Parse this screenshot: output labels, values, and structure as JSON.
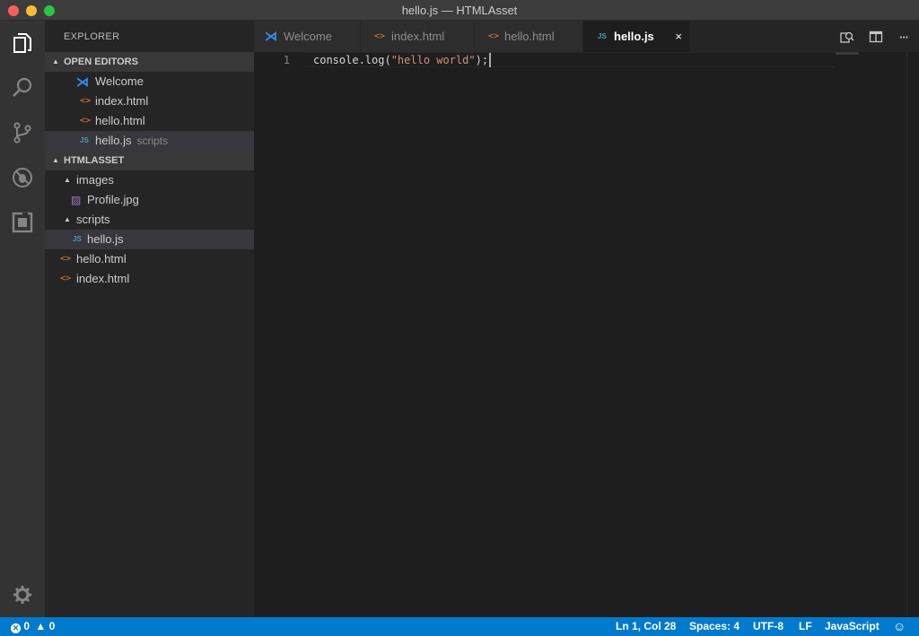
{
  "window": {
    "title": "hello.js — HTMLAsset"
  },
  "activity_bar": {
    "items": [
      {
        "name": "explorer-icon"
      },
      {
        "name": "search-icon"
      },
      {
        "name": "source-control-icon"
      },
      {
        "name": "debug-icon"
      },
      {
        "name": "extensions-icon"
      }
    ],
    "settings": "gear-icon"
  },
  "sidebar": {
    "title": "EXPLORER",
    "open_editors": {
      "label": "OPEN EDITORS",
      "items": [
        {
          "label": "Welcome",
          "icon": "vscode-icon"
        },
        {
          "label": "index.html",
          "icon": "html-file-icon"
        },
        {
          "label": "hello.html",
          "icon": "html-file-icon"
        },
        {
          "label": "hello.js",
          "hint": "scripts",
          "icon": "js-file-icon",
          "selected": true
        }
      ]
    },
    "project": {
      "label": "HTMLASSET",
      "tree": [
        {
          "label": "images",
          "type": "folder",
          "expanded": true
        },
        {
          "label": "Profile.jpg",
          "type": "image"
        },
        {
          "label": "scripts",
          "type": "folder",
          "expanded": true
        },
        {
          "label": "hello.js",
          "type": "js",
          "selected": true
        },
        {
          "label": "hello.html",
          "type": "html"
        },
        {
          "label": "index.html",
          "type": "html"
        }
      ]
    }
  },
  "tabs": [
    {
      "label": "Welcome",
      "icon": "vscode-icon",
      "active": false
    },
    {
      "label": "index.html",
      "icon": "html-file-icon",
      "active": false
    },
    {
      "label": "hello.html",
      "icon": "html-file-icon",
      "active": false
    },
    {
      "label": "hello.js",
      "icon": "js-file-icon",
      "active": true,
      "close": "×"
    }
  ],
  "tab_actions": [
    {
      "name": "open-preview-icon"
    },
    {
      "name": "split-editor-icon"
    },
    {
      "name": "more-actions-icon",
      "glyph": "···"
    }
  ],
  "editor": {
    "line_number": "1",
    "code": {
      "part1": "console.log(",
      "string": "\"hello world\"",
      "part2": ");"
    },
    "colors": {
      "text": "#d4d4d4",
      "string": "#ce9178",
      "background": "#1e1e1e"
    }
  },
  "status_bar": {
    "errors": "0",
    "warnings": "0",
    "position": "Ln 1, Col 28",
    "indent": "Spaces: 4",
    "encoding": "UTF-8",
    "eol": "LF",
    "language": "JavaScript",
    "feedback": "smiley-icon",
    "color": "#007acc"
  }
}
